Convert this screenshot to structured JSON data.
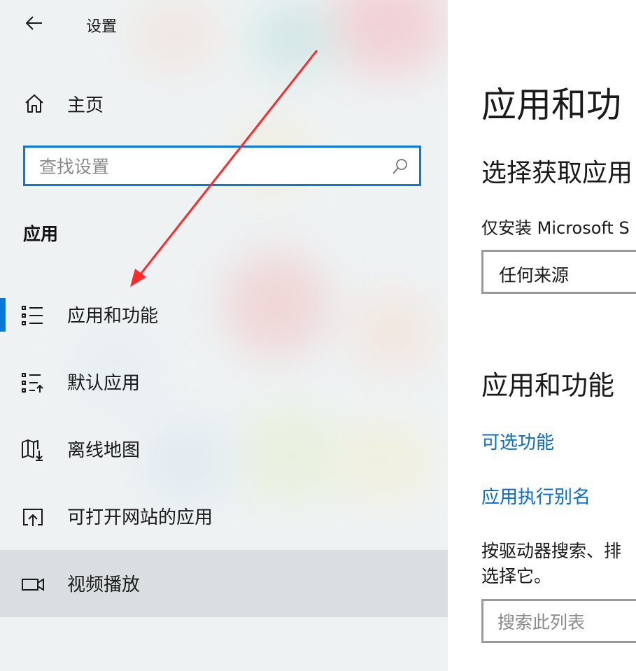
{
  "header": {
    "title": "设置",
    "back_icon": "back-arrow-icon"
  },
  "home": {
    "label": "主页",
    "icon": "home-icon"
  },
  "search": {
    "placeholder": "查找设置",
    "icon": "search-icon"
  },
  "section": {
    "title": "应用"
  },
  "nav": {
    "items": [
      {
        "label": "应用和功能",
        "icon": "apps-features-icon",
        "selected": true
      },
      {
        "label": "默认应用",
        "icon": "default-apps-icon"
      },
      {
        "label": "离线地图",
        "icon": "offline-maps-icon"
      },
      {
        "label": "可打开网站的应用",
        "icon": "apps-for-websites-icon"
      },
      {
        "label": "视频播放",
        "icon": "video-playback-icon",
        "hovered": true
      }
    ]
  },
  "content": {
    "title": "应用和功",
    "subtitle": "选择获取应用",
    "install_text": "仅安装 Microsoft S",
    "source_dropdown": {
      "value": "任何来源"
    },
    "section_title": "应用和功能",
    "links": [
      "可选功能",
      "应用执行别名"
    ],
    "description_line1": "按驱动器搜索、排",
    "description_line2": "选择它。",
    "list_search": {
      "placeholder": "搜索此列表"
    }
  },
  "colors": {
    "accent": "#0a78d7",
    "link": "#0a6ec8",
    "annotation_arrow": "#ff2a2a"
  }
}
